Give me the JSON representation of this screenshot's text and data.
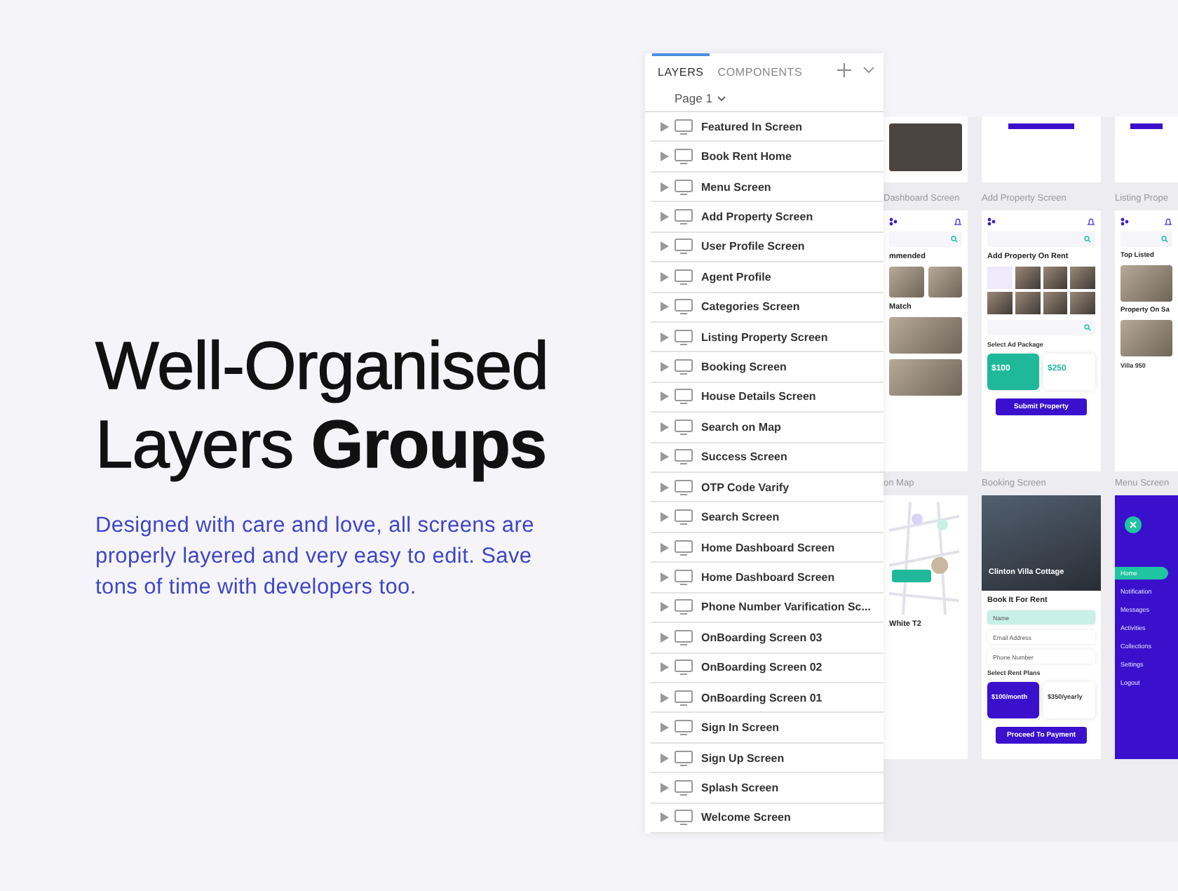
{
  "headline": {
    "lines": [
      "Well-Organised",
      "Layers **Groups**"
    ],
    "description": "Designed with care and love, all screens are properly layered and very easy to edit. Save tons of time with developers too."
  },
  "layers_panel": {
    "tabs": [
      {
        "label": "LAYERS",
        "selected": true
      },
      {
        "label": "COMPONENTS",
        "selected": false
      }
    ],
    "page": "Page 1",
    "layers": [
      {
        "name": "Featured In Screen",
        "expanded": false
      },
      {
        "name": "Book Rent Home",
        "expanded": false
      },
      {
        "name": "Menu Screen",
        "expanded": false
      },
      {
        "name": "Add Property Screen",
        "expanded": false
      },
      {
        "name": "User Profile Screen",
        "expanded": false
      },
      {
        "name": "Agent Profile",
        "expanded": false
      },
      {
        "name": "Categories Screen",
        "expanded": false
      },
      {
        "name": "Listing Property Screen",
        "expanded": false
      },
      {
        "name": "Booking Screen",
        "expanded": false
      },
      {
        "name": "House Details Screen",
        "expanded": false
      },
      {
        "name": "Search on Map",
        "expanded": false
      },
      {
        "name": "Success Screen",
        "expanded": false
      },
      {
        "name": "OTP Code Varify",
        "expanded": false
      },
      {
        "name": "Search Screen",
        "expanded": false
      },
      {
        "name": "Home Dashboard Screen",
        "expanded": false
      },
      {
        "name": "Home Dashboard Screen",
        "expanded": false
      },
      {
        "name": "Phone Number Varification Sc...",
        "expanded": false
      },
      {
        "name": "OnBoarding Screen 03",
        "expanded": false
      },
      {
        "name": "OnBoarding Screen 02",
        "expanded": false
      },
      {
        "name": "OnBoarding Screen 01",
        "expanded": false
      },
      {
        "name": "Sign In Screen",
        "expanded": false
      },
      {
        "name": "Sign Up Screen",
        "expanded": false
      },
      {
        "name": "Splash Screen",
        "expanded": false
      },
      {
        "name": "Welcome Screen",
        "expanded": false
      }
    ]
  },
  "canvas": {
    "columns": [
      {
        "frames": [
          {
            "dark": false,
            "elements": [
              {
                "kind": "photo"
              }
            ]
          },
          {
            "title": "Dashboard Screen",
            "dark": false,
            "elements": [
              {
                "kind": "topbar"
              },
              {
                "kind": "search"
              },
              {
                "kind": "heading",
                "text": "mmended"
              },
              {
                "kind": "photos"
              },
              {
                "kind": "heading",
                "text": "Match"
              },
              {
                "kind": "photo"
              },
              {
                "kind": "photo"
              }
            ]
          },
          {
            "title": "on Map",
            "dark": false,
            "elements": [
              {
                "kind": "map"
              },
              {
                "kind": "heading",
                "text": "White T2"
              }
            ]
          }
        ]
      },
      {
        "frames": [
          {
            "dark": false,
            "elements": [
              {
                "kind": "bar"
              }
            ]
          },
          {
            "title": "Add Property Screen",
            "dark": false,
            "elements": [
              {
                "kind": "topbar"
              },
              {
                "kind": "search"
              },
              {
                "kind": "heading",
                "text": "Add Property On Rent"
              },
              {
                "kind": "gallery"
              },
              {
                "kind": "search"
              },
              {
                "kind": "label",
                "text": "Select Ad Package"
              },
              {
                "kind": "plans",
                "plans": [
                  {
                    "price": "$100",
                    "selected": true
                  },
                  {
                    "price": "$250",
                    "selected": false
                  }
                ]
              },
              {
                "kind": "button",
                "text": "Submit Property"
              }
            ]
          },
          {
            "title": "Booking Screen",
            "dark": false,
            "elements": [
              {
                "kind": "hero",
                "text": "Clinton Villa Cottage"
              },
              {
                "kind": "heading",
                "text": "Book It For Rent"
              },
              {
                "kind": "field",
                "text": "Name",
                "selected": true
              },
              {
                "kind": "field",
                "text": "Email Address",
                "selected": false
              },
              {
                "kind": "field",
                "text": "Phone Number",
                "selected": false
              },
              {
                "kind": "label",
                "text": "Select Rent Plans"
              },
              {
                "kind": "plans",
                "plans": [
                  {
                    "price": "$100/month",
                    "selected": true
                  },
                  {
                    "price": "$350/yearly",
                    "selected": false
                  }
                ]
              },
              {
                "kind": "button",
                "text": "Proceed To Payment"
              }
            ]
          }
        ]
      },
      {
        "frames": [
          {
            "dark": false,
            "elements": [
              {
                "kind": "bar"
              }
            ]
          },
          {
            "title": "Listing Prope",
            "dark": false,
            "elements": [
              {
                "kind": "topbar"
              },
              {
                "kind": "search"
              },
              {
                "kind": "heading",
                "text": "Top Listed"
              },
              {
                "kind": "photo"
              },
              {
                "kind": "heading",
                "text": "Property On Sa"
              },
              {
                "kind": "photo"
              },
              {
                "kind": "label",
                "text": "Villa 950"
              }
            ]
          },
          {
            "title": "Menu Screen",
            "dark": true,
            "elements": [
              {
                "kind": "close"
              },
              {
                "kind": "menu-item",
                "text": "Home",
                "selected": true
              },
              {
                "kind": "menu-item",
                "text": "Notification",
                "selected": false
              },
              {
                "kind": "menu-item",
                "text": "Messages",
                "selected": false
              },
              {
                "kind": "menu-item",
                "text": "Activities",
                "selected": false
              },
              {
                "kind": "menu-item",
                "text": "Collections",
                "selected": false
              },
              {
                "kind": "menu-item",
                "text": "Settings",
                "selected": false
              },
              {
                "kind": "menu-item",
                "text": "Logout",
                "selected": false
              }
            ]
          }
        ]
      }
    ]
  }
}
